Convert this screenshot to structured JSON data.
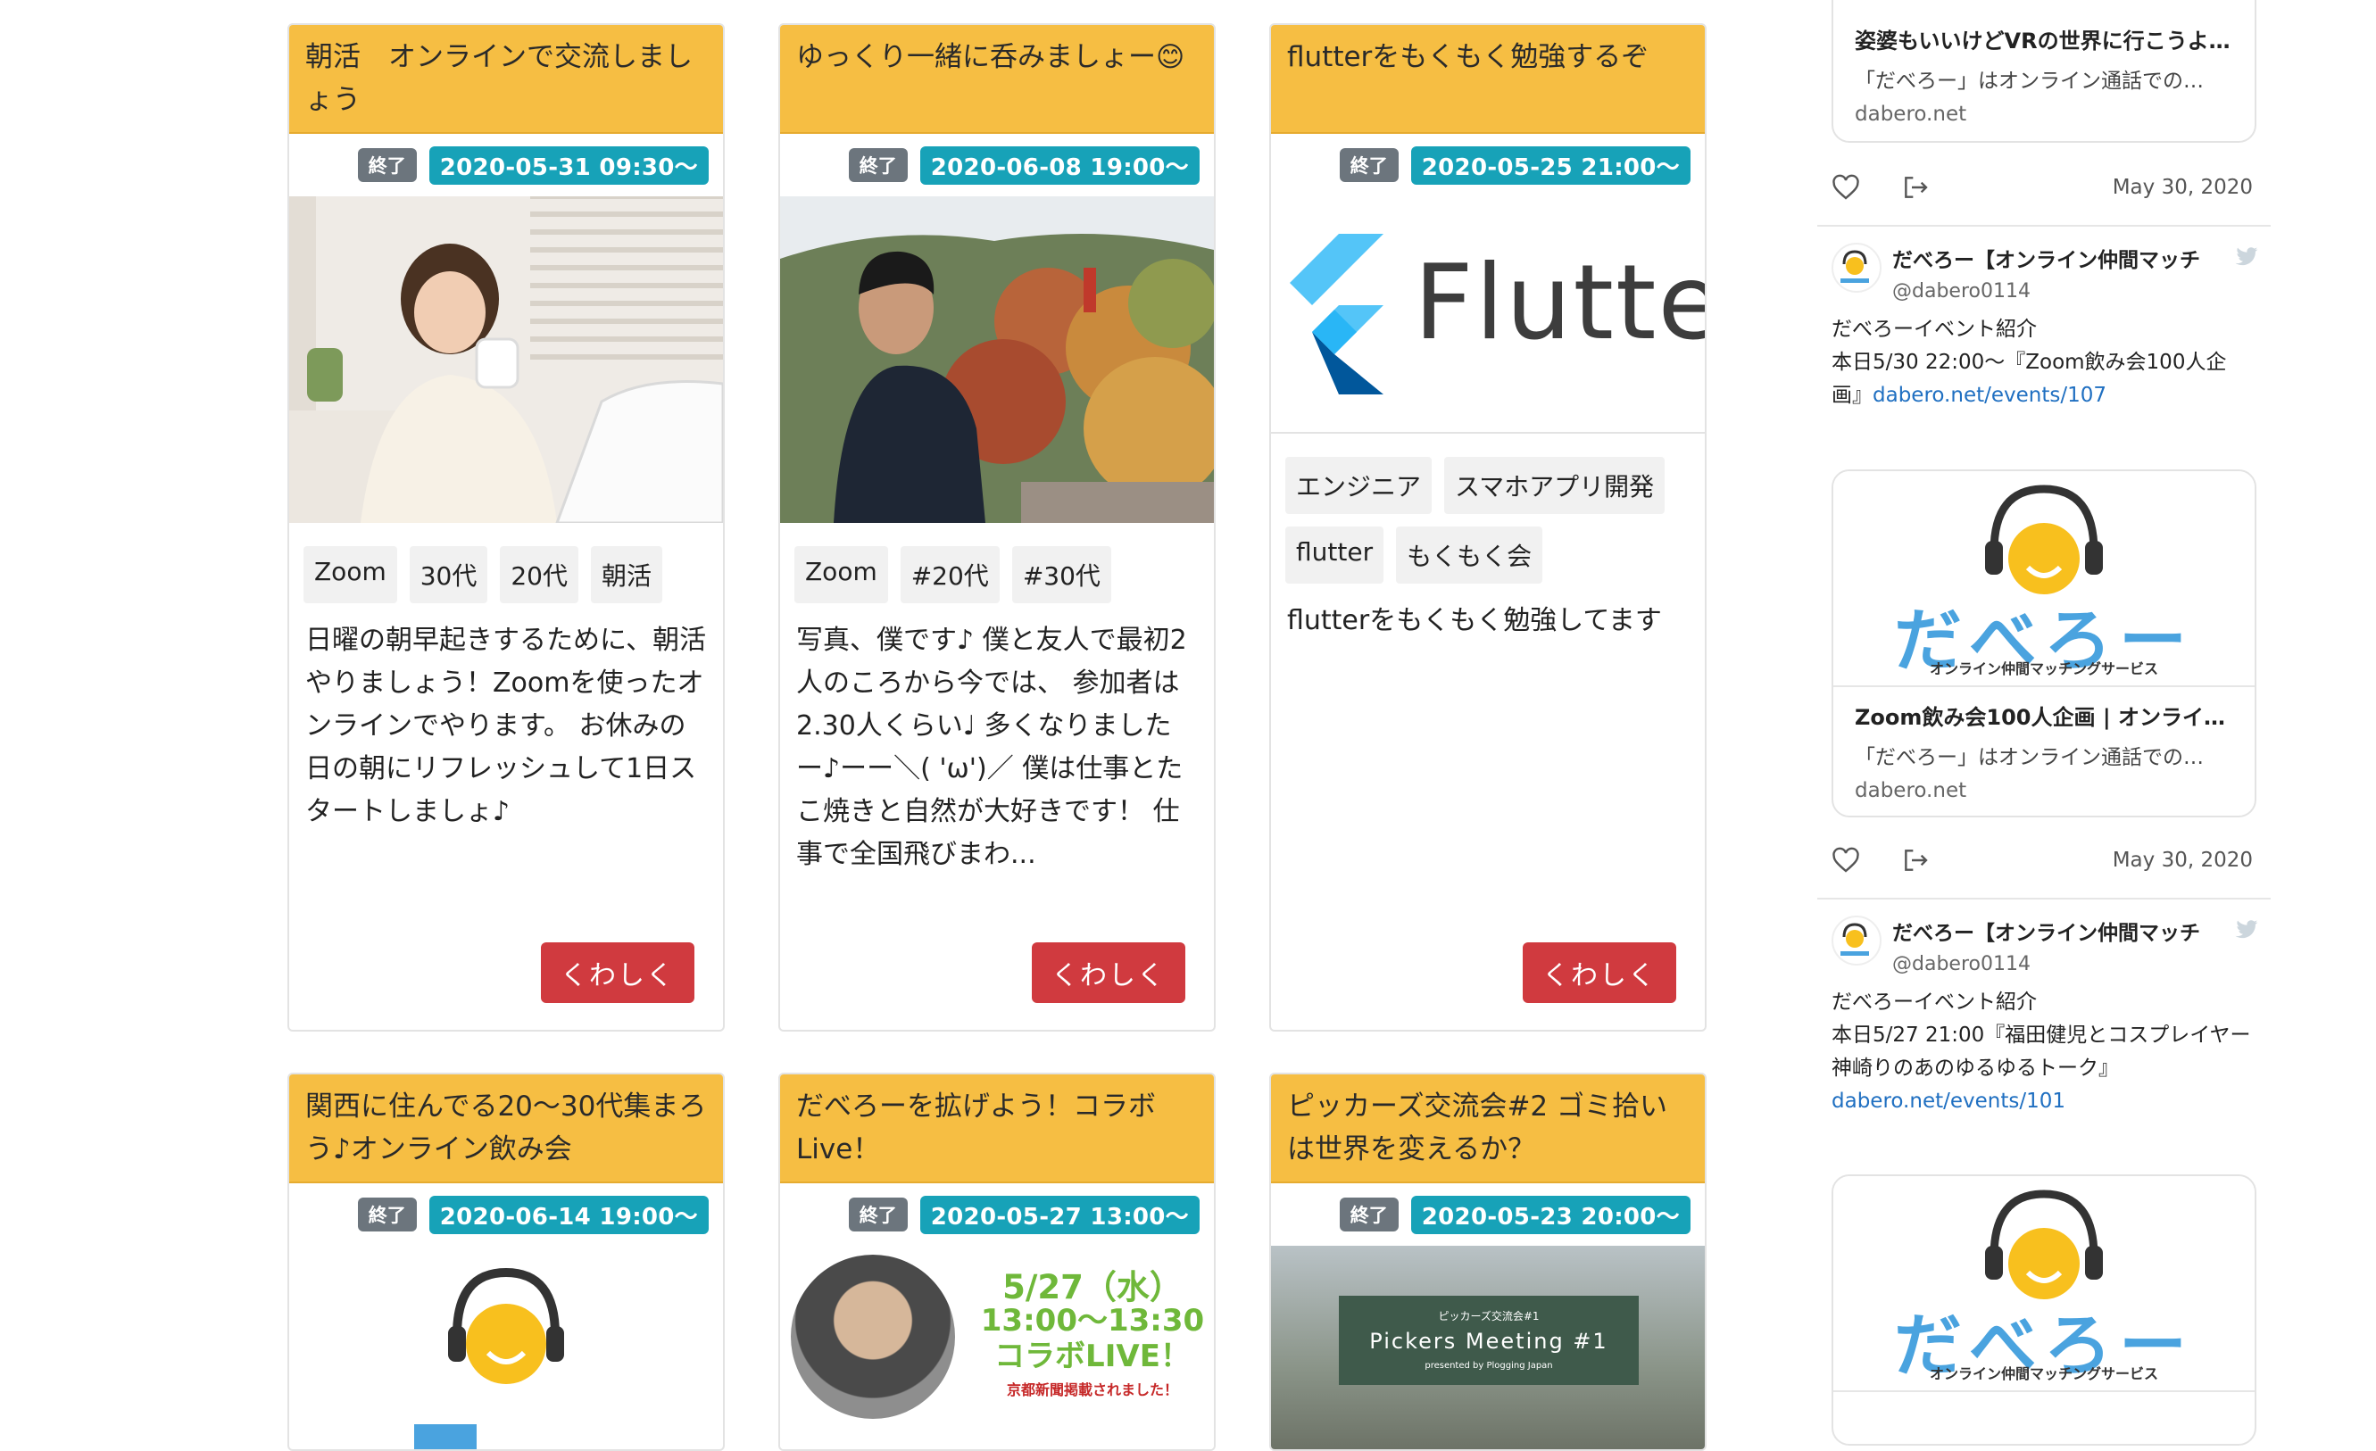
{
  "cards": [
    {
      "title": "朝活　オンラインで交流しましょう",
      "status": "終了",
      "date": "2020-05-31 09:30〜",
      "tags": [
        "Zoom",
        "30代",
        "20代",
        "朝活"
      ],
      "description": "日曜の朝早起きするために、朝活やりましょう！Zoomを使ったオンラインでやります。 お休みの日の朝にリフレッシュして1日スタートしましょ♪",
      "button": "くわしく"
    },
    {
      "title": "ゆっくり一緒に呑みましょー😊",
      "status": "終了",
      "date": "2020-06-08 19:00〜",
      "tags": [
        "Zoom",
        "#20代",
        "#30代"
      ],
      "description": "写真、僕です♪ 僕と友人で最初2人のころから今では、 参加者は2.30人くらい♩ 多くなりましたー♪ーー＼( 'ω')／ 僕は仕事とたこ焼きと自然が大好きです！ 仕事で全国飛びまわ...",
      "button": "くわしく"
    },
    {
      "title": "flutterをもくもく勉強するぞ",
      "status": "終了",
      "date": "2020-05-25 21:00〜",
      "thumb_text": "Flutter",
      "tags": [
        "エンジニア",
        "スマホアプリ開発",
        "flutter",
        "もくもく会"
      ],
      "description": "flutterをもくもく勉強してます",
      "button": "くわしく"
    },
    {
      "title": "関西に住んでる20〜30代集まろう♪オンライン飲み会",
      "status": "終了",
      "date": "2020-06-14 19:00〜"
    },
    {
      "title": "だべろーを拡げよう！コラボLive！",
      "status": "終了",
      "date": "2020-05-27 13:00〜",
      "thumb_lines": [
        "5/27（水）",
        "13:00〜13:30",
        "コラボLIVE！",
        "京都新聞掲載されました！"
      ]
    },
    {
      "title": "ピッカーズ交流会#2 ゴミ拾いは世界を変えるか？",
      "status": "終了",
      "date": "2020-05-23 20:00〜",
      "thumb_small": "ピッカーズ交流会#1",
      "thumb_title": "Pickers Meeting #1",
      "thumb_sub": "presented by Plogging Japan"
    }
  ],
  "sidebar": {
    "linkcard_top": {
      "title": "姿婆もいいけどVRの世界に行こうよ…",
      "desc": "「だべろー」はオンライン通話での…",
      "domain": "dabero.net"
    },
    "actions_date_1": "May 30, 2020",
    "tweet1": {
      "name": "だべろー【オンライン仲間マッチ",
      "handle": "@dabero0114",
      "line1": "だべろーイベント紹介",
      "line2": "本日5/30 22:00〜『Zoom飲み会100人企画』",
      "link": "dabero.net/events/107"
    },
    "logo_word": "だべろー",
    "logo_sub": "オンライン仲間マッチングサービス",
    "linkcard_mid": {
      "title": "Zoom飲み会100人企画 | オンライン…",
      "desc": "「だべろー」はオンライン通話での…",
      "domain": "dabero.net"
    },
    "actions_date_2": "May 30, 2020",
    "tweet2": {
      "name": "だべろー【オンライン仲間マッチ",
      "handle": "@dabero0114",
      "line1": "だべろーイベント紹介",
      "line2": "本日5/27 21:00『福田健児とコスプレイヤー神崎りのあのゆるゆるトーク』",
      "link": "dabero.net/events/101"
    }
  },
  "colors": {
    "card_header": "#f6be43",
    "badge_status": "#6c757d",
    "badge_date": "#17a2b8",
    "button": "#d03a3f",
    "link": "#1f6fc1"
  }
}
